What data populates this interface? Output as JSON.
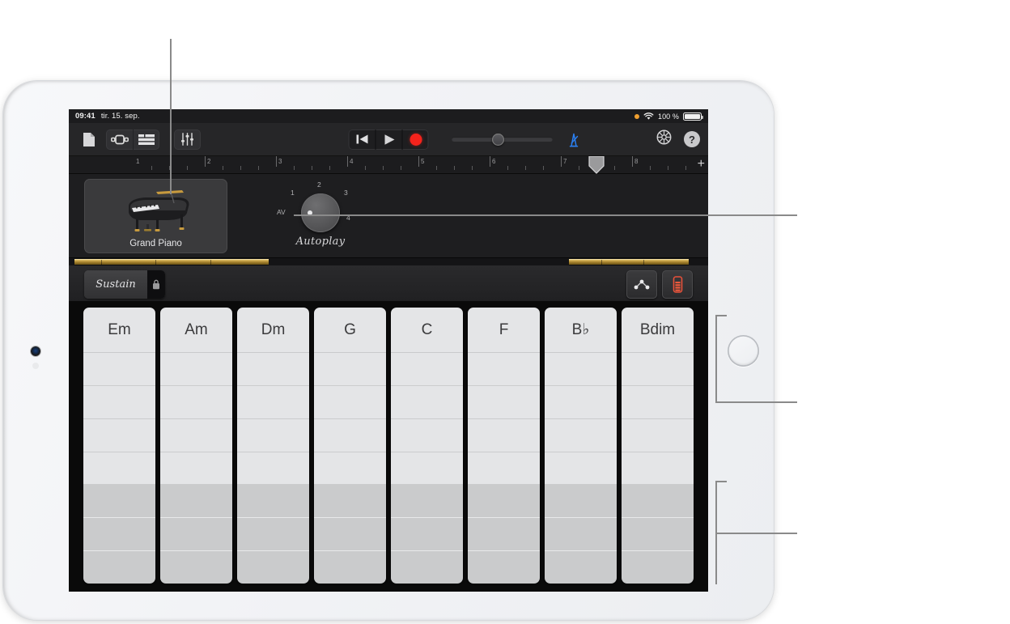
{
  "device": {
    "name": "iPad",
    "home_button": "home-button",
    "camera": "front-camera"
  },
  "status_bar": {
    "time": "09:41",
    "date": "tir. 15. sep.",
    "recording_indicator": "orange-dot",
    "wifi": "wifi-icon",
    "battery_percent": "100 %",
    "battery": "battery-icon"
  },
  "toolbar": {
    "my_songs": "document-icon",
    "view_instrument": "instrument-view-icon",
    "view_tracks": "tracks-view-icon",
    "mixer": "mixer-icon",
    "rewind": "rewind-icon",
    "play": "play-icon",
    "record": "record-icon",
    "volume_label": "master-volume",
    "metronome": "metronome-icon",
    "settings": "gear-icon",
    "help": "?"
  },
  "ruler": {
    "bars": [
      "1",
      "2",
      "3",
      "4",
      "5",
      "6",
      "7",
      "8"
    ],
    "playhead_bar": "7.5",
    "add_section": "+"
  },
  "instrument": {
    "name": "Grand Piano",
    "icon": "grand-piano-image"
  },
  "autoplay": {
    "label": "Autoplay",
    "positions": [
      "AV",
      "1",
      "2",
      "3",
      "4"
    ],
    "selected": "AV"
  },
  "controls": {
    "sustain_label": "Sustain",
    "sustain_lock": "lock-icon",
    "chords_button": "chords-icon",
    "autoplay_button": "autoplay-fader-icon"
  },
  "chord_strips": [
    {
      "name": "Em"
    },
    {
      "name": "Am"
    },
    {
      "name": "Dm"
    },
    {
      "name": "G"
    },
    {
      "name": "C"
    },
    {
      "name": "F"
    },
    {
      "name": "B♭"
    },
    {
      "name": "Bdim"
    }
  ],
  "strip_rows": {
    "light_rows": 4,
    "dark_rows": 3
  },
  "callouts": [
    {
      "id": "callout-instrument",
      "target": "instrument-card"
    },
    {
      "id": "callout-autoplay",
      "target": "autoplay-knob"
    },
    {
      "id": "callout-chord-upper",
      "target": "chord-strips-upper"
    },
    {
      "id": "callout-chord-lower",
      "target": "chord-strips-lower"
    }
  ],
  "colors": {
    "record_red": "#f5231c",
    "metronome_blue": "#2b7ff0",
    "brass": "#b8923a",
    "accent_orange": "#f0a030"
  }
}
